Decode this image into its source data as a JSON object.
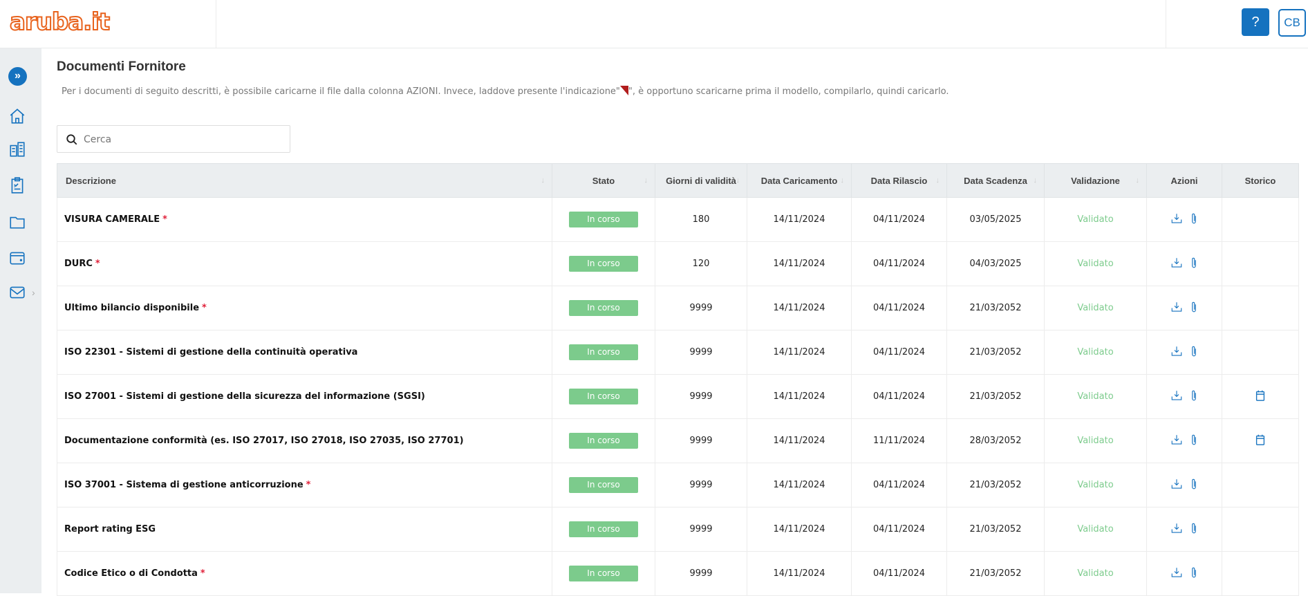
{
  "header": {
    "logo": "aruba.it",
    "help_label": "?",
    "user_initials": "CB"
  },
  "sidebar": {
    "items": [
      {
        "icon": "expand-icon"
      },
      {
        "icon": "home-icon"
      },
      {
        "icon": "building-icon"
      },
      {
        "icon": "clipboard-icon"
      },
      {
        "icon": "folder-icon"
      },
      {
        "icon": "wallet-icon"
      },
      {
        "icon": "mail-icon"
      }
    ]
  },
  "page": {
    "title": "Documenti Fornitore",
    "description_before": "Per i documenti di seguito descritti, è possibile caricarne il file dalla colonna AZIONI. Invece, laddove presente l'indicazione\"",
    "description_after": "\", è opportuno scaricarne prima il modello, compilarlo, quindi caricarlo."
  },
  "search": {
    "placeholder": "Cerca",
    "value": ""
  },
  "table": {
    "columns": [
      "Descrizione",
      "Stato",
      "Giorni di validità",
      "Data Caricamento",
      "Data Rilascio",
      "Data Scadenza",
      "Validazione",
      "Azioni",
      "Storico"
    ],
    "rows": [
      {
        "descrizione": "VISURA CAMERALE",
        "required": "*",
        "stato": "In corso",
        "giorni": "180",
        "caricamento": "14/11/2024",
        "rilascio": "04/11/2024",
        "scadenza": "03/05/2025",
        "validazione": "Validato",
        "storico": false
      },
      {
        "descrizione": "DURC",
        "required": "*",
        "stato": "In corso",
        "giorni": "120",
        "caricamento": "14/11/2024",
        "rilascio": "04/11/2024",
        "scadenza": "04/03/2025",
        "validazione": "Validato",
        "storico": false
      },
      {
        "descrizione": "Ultimo bilancio disponibile",
        "required": "*",
        "stato": "In corso",
        "giorni": "9999",
        "caricamento": "14/11/2024",
        "rilascio": "04/11/2024",
        "scadenza": "21/03/2052",
        "validazione": "Validato",
        "storico": false
      },
      {
        "descrizione": "ISO 22301 - Sistemi di gestione della continuità operativa",
        "required": "",
        "stato": "In corso",
        "giorni": "9999",
        "caricamento": "14/11/2024",
        "rilascio": "04/11/2024",
        "scadenza": "21/03/2052",
        "validazione": "Validato",
        "storico": false
      },
      {
        "descrizione": "ISO 27001 - Sistemi di gestione della sicurezza del informazione (SGSI)",
        "required": "",
        "stato": "In corso",
        "giorni": "9999",
        "caricamento": "14/11/2024",
        "rilascio": "04/11/2024",
        "scadenza": "21/03/2052",
        "validazione": "Validato",
        "storico": true
      },
      {
        "descrizione": "Documentazione conformità (es. ISO 27017, ISO 27018, ISO 27035, ISO 27701)",
        "required": "",
        "stato": "In corso",
        "giorni": "9999",
        "caricamento": "14/11/2024",
        "rilascio": "11/11/2024",
        "scadenza": "28/03/2052",
        "validazione": "Validato",
        "storico": true
      },
      {
        "descrizione": "ISO 37001 - Sistema di gestione anticorruzione",
        "required": "*",
        "stato": "In corso",
        "giorni": "9999",
        "caricamento": "14/11/2024",
        "rilascio": "04/11/2024",
        "scadenza": "21/03/2052",
        "validazione": "Validato",
        "storico": false
      },
      {
        "descrizione": "Report rating ESG",
        "required": "",
        "stato": "In corso",
        "giorni": "9999",
        "caricamento": "14/11/2024",
        "rilascio": "04/11/2024",
        "scadenza": "21/03/2052",
        "validazione": "Validato",
        "storico": false
      },
      {
        "descrizione": "Codice Etico o di Condotta",
        "required": "*",
        "stato": "In corso",
        "giorni": "9999",
        "caricamento": "14/11/2024",
        "rilascio": "04/11/2024",
        "scadenza": "21/03/2052",
        "validazione": "Validato",
        "storico": false
      }
    ]
  },
  "colors": {
    "primary": "#1572bf",
    "success": "#7ccb8c",
    "logo": "#e8621c",
    "required": "#e0213a"
  }
}
